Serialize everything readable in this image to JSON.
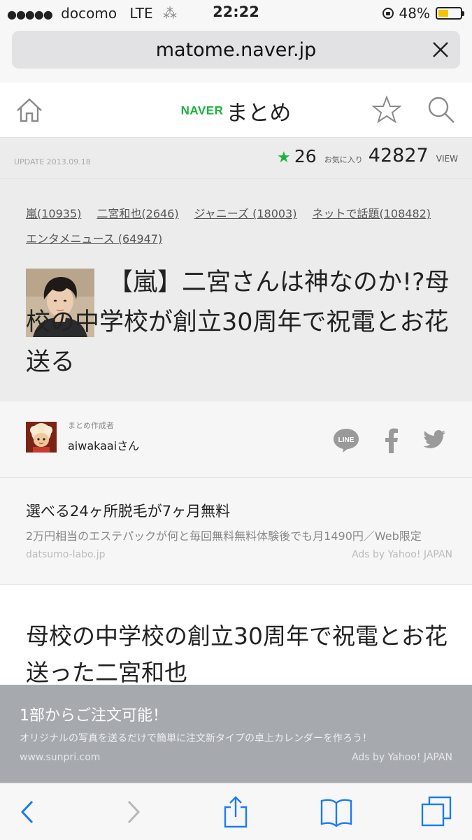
{
  "status": {
    "signal_dots": "●●●●●",
    "carrier": "docomo",
    "network": "LTE",
    "time": "22:22",
    "battery_percent": "48%",
    "battery_level": 0.48,
    "battery_color": "#f5c400"
  },
  "browser": {
    "url": "matome.naver.jp",
    "close_icon": "close-icon"
  },
  "site_header": {
    "brand": "NAVER",
    "brand_suffix": "まとめ",
    "brand_color": "#19b33a",
    "icons": [
      "home-icon",
      "star-icon",
      "search-icon"
    ]
  },
  "meta": {
    "update": "UPDATE 2013.09.18",
    "favorites_count": "26",
    "favorites_label": "お気に入り",
    "views_count": "42827",
    "views_label": "VIEW"
  },
  "tags": [
    "嵐(10935)",
    "二宮和也(2646)",
    "ジャニーズ (18003)",
    "ネットで話題(108482)",
    "エンタメニュース (64947)"
  ],
  "article": {
    "title": "【嵐】二宮さんは神なのか!?母校の中学校が創立30周年で祝電とお花送る"
  },
  "author": {
    "role": "まとめ作成者",
    "name": "aiwakaaiさん",
    "share_icons": [
      "line-icon",
      "facebook-icon",
      "twitter-icon"
    ],
    "line_label": "LINE"
  },
  "ad1": {
    "title": "選べる24ヶ所脱毛が7ヶ月無料",
    "description": "2万円相当のエステパックが何と毎回無料無料体験後でも月1490円／Web限定",
    "url": "datsumo-labo.jp",
    "by": "Ads by Yahoo! JAPAN"
  },
  "body": {
    "heading": "母校の中学校の創立30周年で祝電とお花送った二宮和也"
  },
  "ad2": {
    "title": "1部からご注文可能！",
    "description": "オリジナルの写真を送るだけで簡単に注文新タイプの卓上カレンダーを作ろう！",
    "url": "www.sunpri.com",
    "by": "Ads by Yahoo! JAPAN"
  },
  "toolbar": {
    "icons": [
      "back-icon",
      "forward-icon",
      "share-icon",
      "bookmarks-icon",
      "tabs-icon"
    ]
  }
}
